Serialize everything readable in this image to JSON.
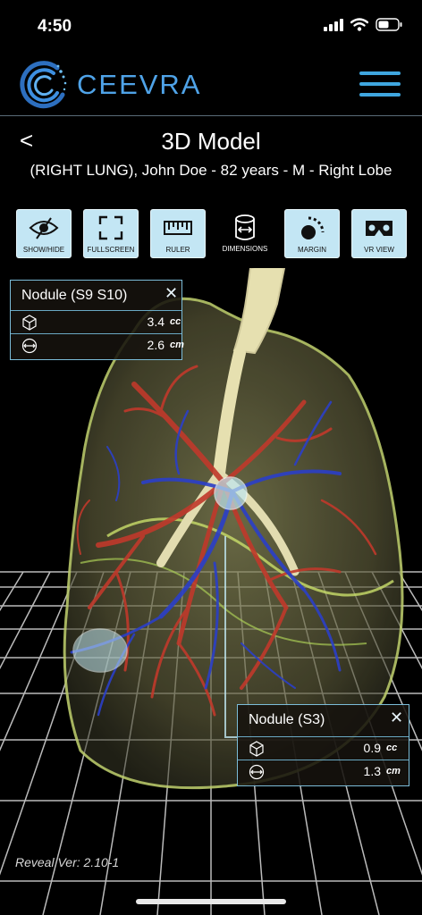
{
  "status_bar": {
    "time": "4:50",
    "icons": [
      "signal-icon",
      "wifi-icon",
      "battery-icon"
    ]
  },
  "header": {
    "brand": "CEEVRA",
    "logo_icon": "ceevra-logo-icon",
    "menu_icon": "hamburger-menu-icon",
    "accent_color": "#3fa6df"
  },
  "page": {
    "back_label": "<",
    "title": "3D Model",
    "patient_info": "(RIGHT LUNG), John Doe - 82 years - M - Right Lobe"
  },
  "toolbar": {
    "items": [
      {
        "label": "SHOW/HIDE",
        "icon": "eye-slash-icon"
      },
      {
        "label": "FULLSCREEN",
        "icon": "fullscreen-icon"
      },
      {
        "label": "RULER",
        "icon": "ruler-icon"
      },
      {
        "label": "DIMENSIONS",
        "icon": "dimensions-cylinder-icon"
      },
      {
        "label": "MARGIN",
        "icon": "margin-icon"
      },
      {
        "label": "VR VIEW",
        "icon": "vr-headset-icon"
      }
    ]
  },
  "nodules": [
    {
      "title": "Nodule (S9 S10)",
      "close": "✕",
      "volume": "3.4",
      "volume_unit": "cc",
      "diameter": "2.6",
      "diameter_unit": "cm"
    },
    {
      "title": "Nodule (S3)",
      "close": "✕",
      "volume": "0.9",
      "volume_unit": "cc",
      "diameter": "1.3",
      "diameter_unit": "cm"
    }
  ],
  "footer": {
    "version": "Reveal Ver: 2.10-1"
  }
}
